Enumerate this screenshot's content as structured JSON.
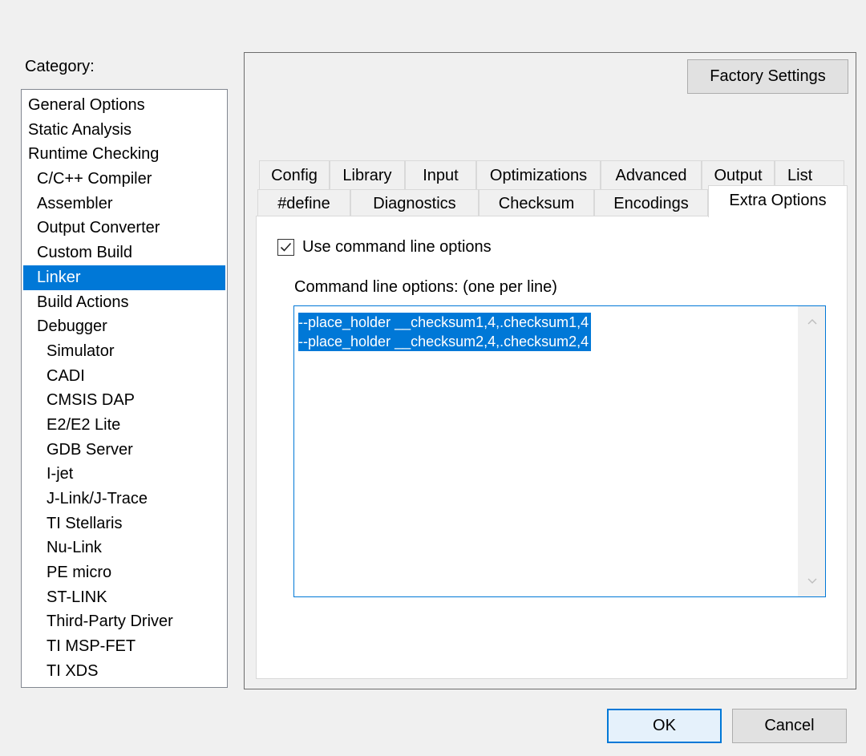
{
  "category": {
    "label": "Category:",
    "items": [
      {
        "label": "General Options",
        "level": 0
      },
      {
        "label": "Static Analysis",
        "level": 0
      },
      {
        "label": "Runtime Checking",
        "level": 0
      },
      {
        "label": "C/C++ Compiler",
        "level": 1
      },
      {
        "label": "Assembler",
        "level": 1
      },
      {
        "label": "Output Converter",
        "level": 1
      },
      {
        "label": "Custom Build",
        "level": 1
      },
      {
        "label": "Linker",
        "level": 1,
        "selected": true
      },
      {
        "label": "Build Actions",
        "level": 1
      },
      {
        "label": "Debugger",
        "level": 1
      },
      {
        "label": "Simulator",
        "level": 2
      },
      {
        "label": "CADI",
        "level": 2
      },
      {
        "label": "CMSIS DAP",
        "level": 2
      },
      {
        "label": "E2/E2 Lite",
        "level": 2
      },
      {
        "label": "GDB Server",
        "level": 2
      },
      {
        "label": "I-jet",
        "level": 2
      },
      {
        "label": "J-Link/J-Trace",
        "level": 2
      },
      {
        "label": "TI Stellaris",
        "level": 2
      },
      {
        "label": "Nu-Link",
        "level": 2
      },
      {
        "label": "PE micro",
        "level": 2
      },
      {
        "label": "ST-LINK",
        "level": 2
      },
      {
        "label": "Third-Party Driver",
        "level": 2
      },
      {
        "label": "TI MSP-FET",
        "level": 2
      },
      {
        "label": "TI XDS",
        "level": 2
      }
    ]
  },
  "buttons": {
    "factory_settings": "Factory Settings",
    "ok": "OK",
    "cancel": "Cancel"
  },
  "tabs": {
    "row1": [
      "Config",
      "Library",
      "Input",
      "Optimizations",
      "Advanced",
      "Output",
      "List"
    ],
    "row2": [
      "#define",
      "Diagnostics",
      "Checksum",
      "Encodings",
      "Extra Options"
    ],
    "active": "Extra Options"
  },
  "extra_options": {
    "use_command_line_label": "Use command line options",
    "use_command_line_checked": true,
    "command_line_label": "Command line options:  (one per line)",
    "command_lines": [
      "--place_holder __checksum1,4,.checksum1,4",
      "--place_holder __checksum2,4,.checksum2,4"
    ]
  },
  "colors": {
    "selection": "#0078d7",
    "dialog_bg": "#f0f0f0"
  }
}
